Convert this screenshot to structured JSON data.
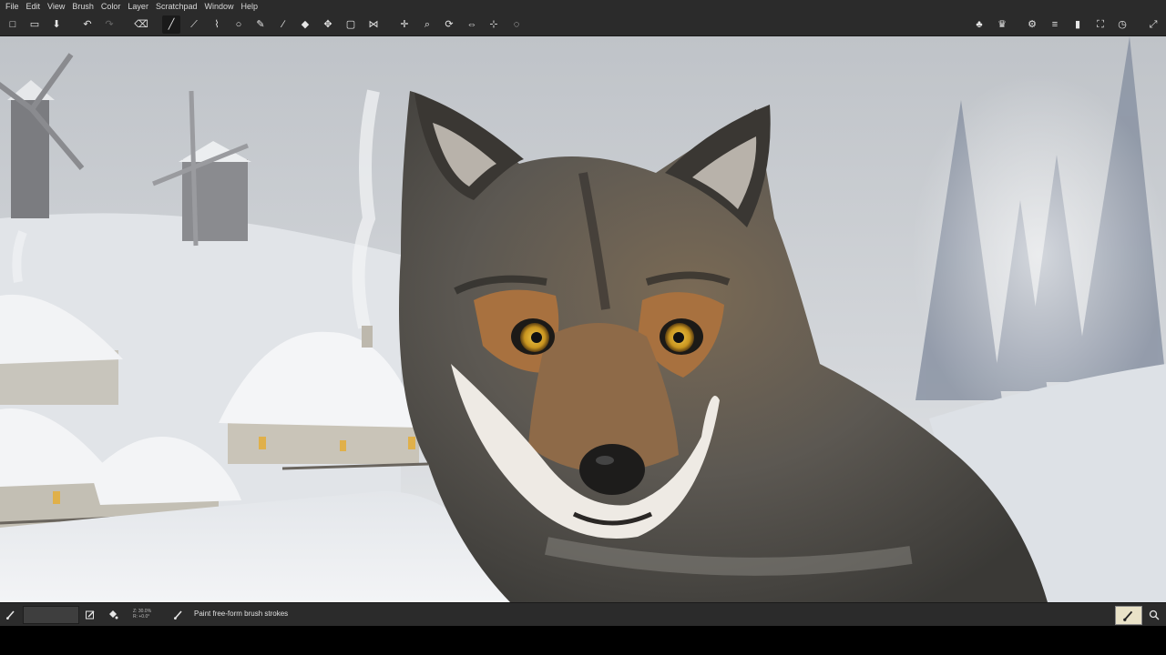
{
  "menu": [
    "File",
    "Edit",
    "View",
    "Brush",
    "Color",
    "Layer",
    "Scratchpad",
    "Window",
    "Help"
  ],
  "toolbar": {
    "left_tools": [
      {
        "name": "new-file-icon",
        "glyph": "□"
      },
      {
        "name": "open-file-icon",
        "glyph": "▭"
      },
      {
        "name": "save-icon",
        "glyph": "⬇"
      },
      {
        "name": "undo-icon",
        "glyph": "↶"
      },
      {
        "name": "redo-icon",
        "glyph": "↷"
      },
      {
        "name": "eraser-icon",
        "glyph": "⌫"
      },
      {
        "name": "brush-tool-icon",
        "glyph": "╱"
      },
      {
        "name": "stroke-tool-icon",
        "glyph": "⟋"
      },
      {
        "name": "lasso-brush-icon",
        "glyph": "⌇"
      },
      {
        "name": "ellipse-tool-icon",
        "glyph": "○"
      },
      {
        "name": "pen-tool-icon",
        "glyph": "✎"
      },
      {
        "name": "color-picker-icon",
        "glyph": "∕"
      },
      {
        "name": "fill-tool-icon",
        "glyph": "◆"
      },
      {
        "name": "move-layer-icon",
        "glyph": "✥"
      },
      {
        "name": "frame-tool-icon",
        "glyph": "▢"
      },
      {
        "name": "symmetry-icon",
        "glyph": "⋈"
      },
      {
        "name": "pan-view-icon",
        "glyph": "✛"
      },
      {
        "name": "zoom-view-icon",
        "glyph": "⌕"
      },
      {
        "name": "rotate-view-icon",
        "glyph": "⟳"
      },
      {
        "name": "mirror-view-icon",
        "glyph": "⇔"
      },
      {
        "name": "reset-view-icon",
        "glyph": "⊹"
      },
      {
        "name": "fit-view-icon",
        "glyph": "◌"
      }
    ],
    "right_tools": [
      {
        "name": "brush-settings-icon",
        "glyph": "♣"
      },
      {
        "name": "palette-icon",
        "glyph": "♛"
      },
      {
        "name": "preferences-icon",
        "glyph": "⚙"
      },
      {
        "name": "layers-icon",
        "glyph": "≡"
      },
      {
        "name": "scratchpad-icon",
        "glyph": "▮"
      },
      {
        "name": "fullscreen-icon",
        "glyph": "⛶"
      },
      {
        "name": "history-icon",
        "glyph": "◷"
      },
      {
        "name": "expand-icon",
        "glyph": "⤢"
      }
    ]
  },
  "status": {
    "zoom_line1": "Z: 30.0%",
    "zoom_line2": "R: +0.0°",
    "message": "Paint free-form brush strokes"
  },
  "colors": {
    "ui_bg": "#2b2b2b",
    "current_color": "#e9e2c8",
    "sky": "#c9ccd0",
    "snow": "#eef0f2",
    "wolf_grey": "#5e5c58",
    "wolf_tan": "#9b6b3e",
    "eye": "#d9a829"
  }
}
